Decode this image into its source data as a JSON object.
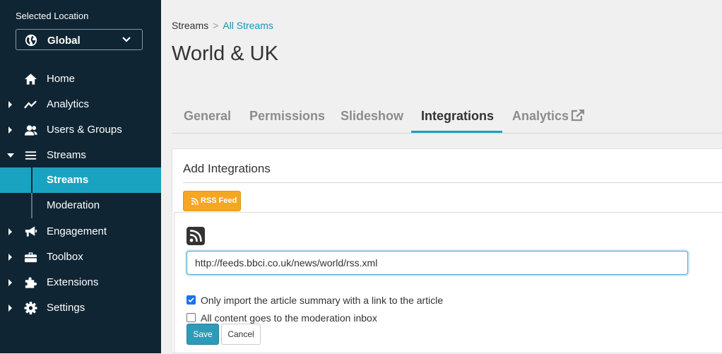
{
  "sidebar": {
    "location_label": "Selected Location",
    "location_value": "Global",
    "nav": [
      {
        "label": "Home",
        "icon": "home-icon"
      },
      {
        "label": "Analytics",
        "icon": "analytics-icon"
      },
      {
        "label": "Users & Groups",
        "icon": "users-icon"
      },
      {
        "label": "Streams",
        "icon": "list-icon"
      },
      {
        "label": "Engagement",
        "icon": "megaphone-icon"
      },
      {
        "label": "Toolbox",
        "icon": "toolbox-icon"
      },
      {
        "label": "Extensions",
        "icon": "puzzle-icon"
      },
      {
        "label": "Settings",
        "icon": "gear-icon"
      }
    ],
    "streams_sub": [
      {
        "label": "Streams",
        "active": true
      },
      {
        "label": "Moderation",
        "active": false
      }
    ]
  },
  "breadcrumb": {
    "parent": "Streams",
    "separator": ">",
    "current": "All Streams"
  },
  "page_title": "World & UK",
  "tabs": [
    {
      "label": "General"
    },
    {
      "label": "Permissions"
    },
    {
      "label": "Slideshow"
    },
    {
      "label": "Integrations",
      "active": true
    },
    {
      "label": "Analytics"
    }
  ],
  "integrations": {
    "heading": "Add Integrations",
    "rss_button": "RSS Feed",
    "url_value": "http://feeds.bbci.co.uk/news/world/rss.xml",
    "option_summary": "Only import the article summary with a link to the article",
    "option_summary_checked": true,
    "option_moderation": "All content goes to the moderation inbox",
    "option_moderation_checked": false,
    "save_label": "Save",
    "cancel_label": "Cancel"
  },
  "colors": {
    "sidebar_bg": "#0f2533",
    "accent": "#1aa3c0",
    "rss_orange": "#f5a623",
    "save_blue": "#2d9ab8"
  }
}
